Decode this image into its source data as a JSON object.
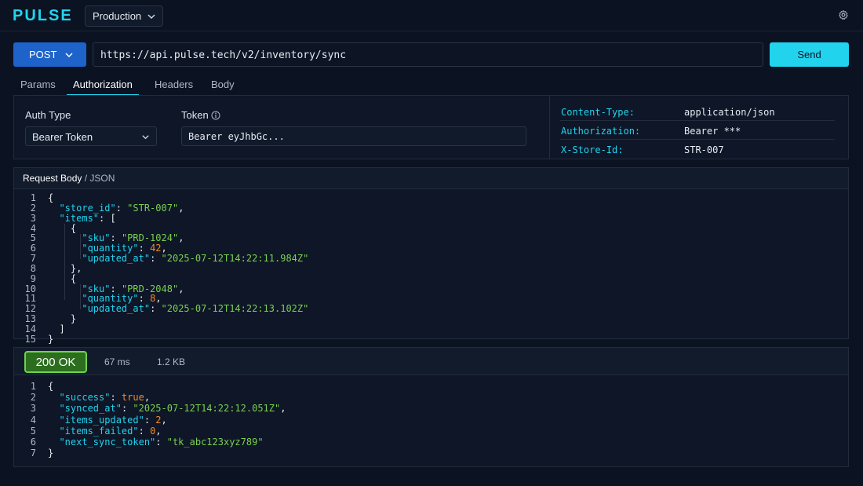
{
  "app": {
    "logo": "PULSE",
    "environment": "Production"
  },
  "request": {
    "method": "POST",
    "url": "https://api.pulse.tech/v2/inventory/sync",
    "send_label": "Send"
  },
  "tabs": [
    "Params",
    "Authorization",
    "Headers",
    "Body"
  ],
  "active_tab": "Authorization",
  "auth": {
    "type_label": "Auth Type",
    "type_value": "Bearer Token",
    "token_label": "Token",
    "token_value": "Bearer eyJhbGc..."
  },
  "headers": [
    {
      "key": "Content-Type:",
      "value": "application/json"
    },
    {
      "key": "Authorization:",
      "value": "Bearer ***"
    },
    {
      "key": "X-Store-Id:",
      "value": "STR-007"
    }
  ],
  "request_body": {
    "title": "Request Body",
    "format": "JSON",
    "lines": [
      "{",
      "  \"store_id\": \"STR-007\",",
      "  \"items\": [",
      "    {",
      "      \"sku\": \"PRD-1024\",",
      "      \"quantity\": 42,",
      "      \"updated_at\": \"2025-07-12T14:22:11.984Z\"",
      "    },",
      "    {",
      "      \"sku\": \"PRD-2048\",",
      "      \"quantity\": 8,",
      "      \"updated_at\": \"2025-07-12T14:22:13.102Z\"",
      "    }",
      "  ]",
      "}"
    ]
  },
  "response": {
    "status": "200 OK",
    "time": "67 ms",
    "size": "1.2 KB",
    "lines": [
      "{",
      "  \"success\": true,",
      "  \"synced_at\": \"2025-07-12T14:22:12.051Z\",",
      "  \"items_updated\": 2,",
      "  \"items_failed\": 0,",
      "  \"next_sync_token\": \"tk_abc123xyz789\"",
      "}"
    ]
  },
  "colors": {
    "accent": "#22d3ee",
    "method": "#1e63c9",
    "success": "#6fd34f",
    "string": "#7bd04e",
    "number": "#f08a2c"
  }
}
